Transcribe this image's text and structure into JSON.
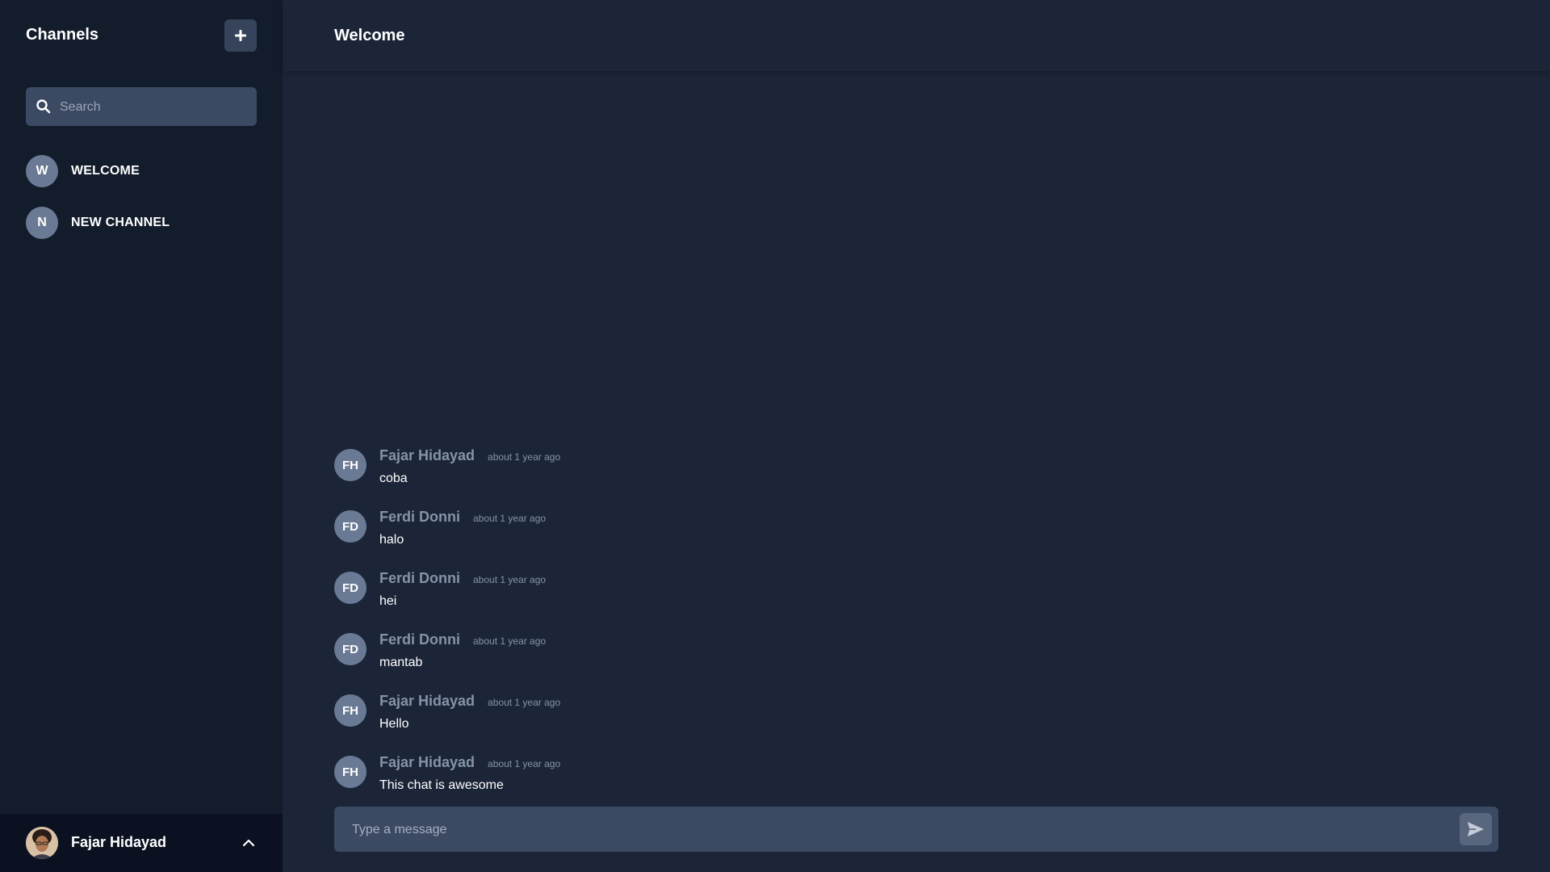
{
  "sidebar": {
    "title": "Channels",
    "search": {
      "placeholder": "Search",
      "value": ""
    },
    "channels": [
      {
        "initial": "W",
        "label": "WELCOME"
      },
      {
        "initial": "N",
        "label": "NEW CHANNEL"
      }
    ],
    "user": {
      "name": "Fajar Hidayad"
    }
  },
  "main": {
    "channel_title": "Welcome",
    "messages": [
      {
        "initials": "FH",
        "author": "Fajar Hidayad",
        "time": "about 1 year ago",
        "text": "coba"
      },
      {
        "initials": "FD",
        "author": "Ferdi Donni",
        "time": "about 1 year ago",
        "text": "halo"
      },
      {
        "initials": "FD",
        "author": "Ferdi Donni",
        "time": "about 1 year ago",
        "text": "hei"
      },
      {
        "initials": "FD",
        "author": "Ferdi Donni",
        "time": "about 1 year ago",
        "text": "mantab"
      },
      {
        "initials": "FH",
        "author": "Fajar Hidayad",
        "time": "about 1 year ago",
        "text": "Hello"
      },
      {
        "initials": "FH",
        "author": "Fajar Hidayad",
        "time": "about 1 year ago",
        "text": "This chat is awesome"
      }
    ],
    "composer": {
      "placeholder": "Type a message",
      "value": ""
    }
  },
  "icons": {
    "add": "plus-icon",
    "search": "search-icon",
    "chevron": "chevron-up-icon",
    "send": "send-icon"
  },
  "colors": {
    "sidebar_bg": "#131c2b",
    "main_bg": "#1b2537",
    "footer_bg": "#0b1120",
    "input_bg": "#3b4a62",
    "avatar_bg": "#6b7a94",
    "muted_text": "#8593a8"
  }
}
